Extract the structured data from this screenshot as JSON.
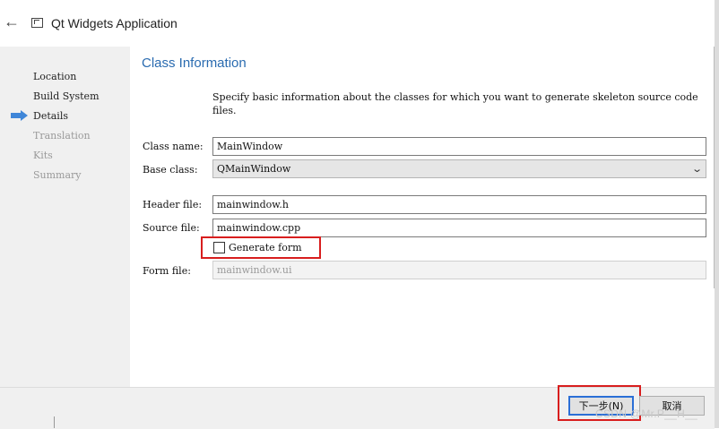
{
  "window": {
    "title": "Qt Widgets Application"
  },
  "sidebar": {
    "items": [
      {
        "label": "Location",
        "state": "done"
      },
      {
        "label": "Build System",
        "state": "done"
      },
      {
        "label": "Details",
        "state": "current"
      },
      {
        "label": "Translation",
        "state": "pending"
      },
      {
        "label": "Kits",
        "state": "pending"
      },
      {
        "label": "Summary",
        "state": "pending"
      }
    ]
  },
  "page": {
    "heading": "Class Information",
    "description": "Specify basic information about the classes for which you want to generate skeleton source code files."
  },
  "form": {
    "class_name": {
      "label": "Class name:",
      "value": "MainWindow"
    },
    "base_class": {
      "label": "Base class:",
      "value": "QMainWindow"
    },
    "header_file": {
      "label": "Header file:",
      "value": "mainwindow.h"
    },
    "source_file": {
      "label": "Source file:",
      "value": "mainwindow.cpp"
    },
    "generate_form": {
      "label": "Generate form",
      "checked": false
    },
    "form_file": {
      "label": "Form file:",
      "value": "mainwindow.ui",
      "enabled": false
    }
  },
  "buttons": {
    "next": "下一步(N)",
    "cancel": "取消"
  },
  "watermark": "CSDN @Mr.P__H__",
  "colors": {
    "heading": "#2a6bb0",
    "highlight": "#d81e1e",
    "focus": "#2b6fd6",
    "current_arrow": "#3f86d8"
  }
}
